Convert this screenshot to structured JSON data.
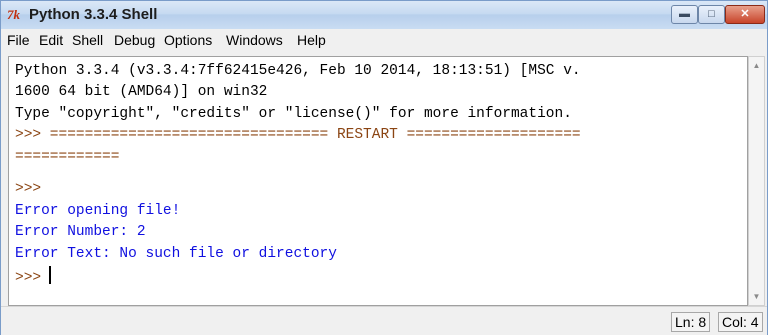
{
  "window": {
    "title": "Python 3.3.4 Shell",
    "icon_glyph": "7k"
  },
  "menu": [
    "File",
    "Edit",
    "Shell",
    "Debug",
    "Options",
    "Windows",
    "Help"
  ],
  "shell_lines": [
    "Python 3.3.4 (v3.3.4:7ff62415e426, Feb 10 2014, 18:13:51) [MSC v.",
    "1600 64 bit (AMD64)] on win32",
    "Type \"copyright\", \"credits\" or \"license()\" for more information.",
    ">>> ================================ RESTART ====================",
    "============",
    ">>>",
    "Error opening file!",
    "Error Number: 2",
    "Error Text: No such file or directory",
    ">>>"
  ],
  "status": {
    "line": "Ln: 8",
    "col": "Col: 4"
  },
  "colors": {
    "output": "#1010e0",
    "prompt": "#8b4513",
    "text": "#000000"
  },
  "icons": [
    "python-idle-icon",
    "minimize-icon",
    "maximize-icon",
    "close-icon",
    "scroll-up-icon",
    "scroll-down-icon"
  ]
}
